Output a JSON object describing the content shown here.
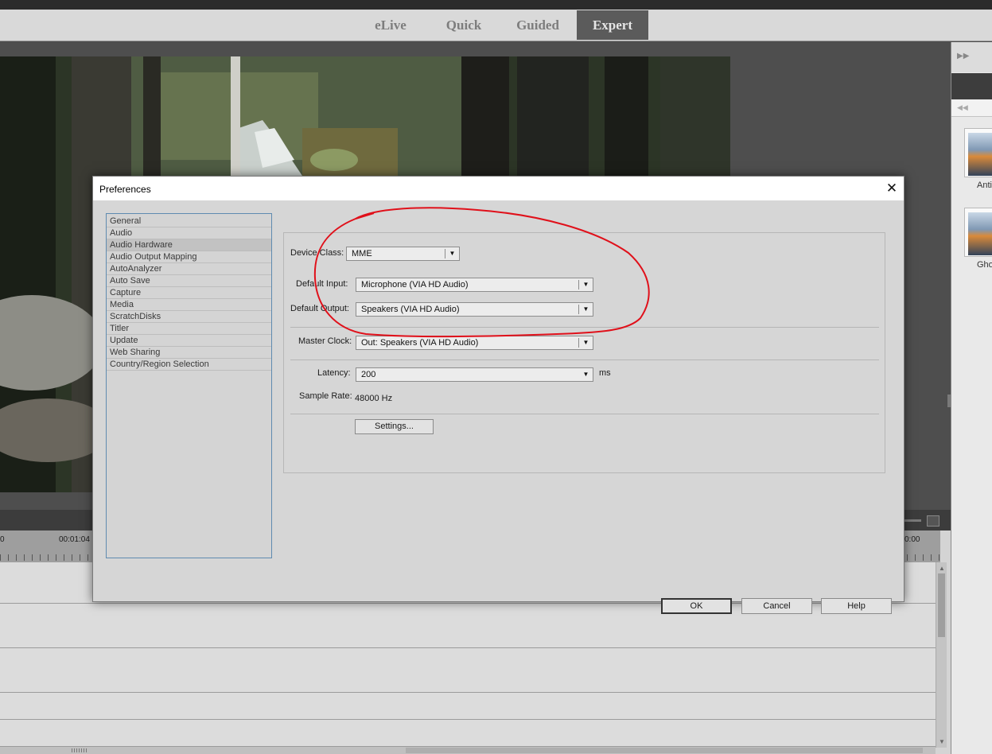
{
  "modes": [
    {
      "label": "eLive"
    },
    {
      "label": "Quick"
    },
    {
      "label": "Guided"
    },
    {
      "label": "Expert",
      "active": true
    }
  ],
  "right_panel": {
    "items": [
      {
        "label": "Anti",
        "icon": "media-thumbnail-icon"
      },
      {
        "label": "Gho",
        "icon": "media-thumbnail-icon"
      }
    ]
  },
  "timeline": {
    "times": [
      "0",
      "00:01:04",
      "0:00"
    ]
  },
  "dialog": {
    "title": "Preferences",
    "close_glyph": "✕",
    "categories": [
      {
        "label": "General"
      },
      {
        "label": "Audio"
      },
      {
        "label": "Audio Hardware",
        "selected": true
      },
      {
        "label": "Audio Output Mapping"
      },
      {
        "label": "AutoAnalyzer"
      },
      {
        "label": "Auto Save"
      },
      {
        "label": "Capture"
      },
      {
        "label": "Media"
      },
      {
        "label": "ScratchDisks"
      },
      {
        "label": "Titler"
      },
      {
        "label": "Update"
      },
      {
        "label": "Web Sharing"
      },
      {
        "label": "Country/Region Selection"
      }
    ],
    "audio_hardware": {
      "device_class_label": "Device Class:",
      "device_class_value": "MME",
      "default_input_label": "Default Input:",
      "default_input_value": "Microphone (VIA HD Audio)",
      "default_output_label": "Default Output:",
      "default_output_value": "Speakers (VIA HD Audio)",
      "master_clock_label": "Master Clock:",
      "master_clock_value": "Out: Speakers (VIA HD Audio)",
      "latency_label": "Latency:",
      "latency_value": "200",
      "latency_unit": "ms",
      "sample_rate_label": "Sample Rate:",
      "sample_rate_value": "48000 Hz",
      "settings_button": "Settings..."
    },
    "buttons": {
      "ok": "OK",
      "cancel": "Cancel",
      "help": "Help"
    }
  },
  "colors": {
    "annotation": "#e0101a",
    "selection_border": "#5f8bb0",
    "active_mode_tab": "#5b5b5b"
  }
}
